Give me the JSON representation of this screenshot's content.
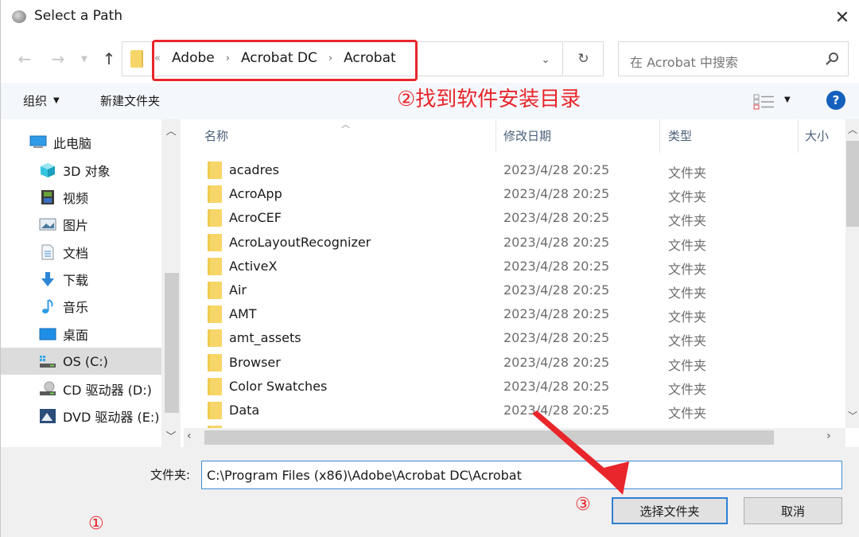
{
  "window": {
    "title": "Select a Path",
    "close_icon": "close-icon"
  },
  "nav": {
    "back_icon": "back-arrow-icon",
    "forward_icon": "forward-arrow-icon",
    "recent_icon": "chevron-down-icon",
    "up_icon": "up-arrow-icon"
  },
  "address": {
    "overflow": "«",
    "crumbs": [
      "Adobe",
      "Acrobat DC",
      "Acrobat"
    ],
    "separator": "›"
  },
  "search": {
    "placeholder": "在 Acrobat 中搜索"
  },
  "toolbar": {
    "organize_label": "组织",
    "new_folder_label": "新建文件夹",
    "help_label": "?"
  },
  "annotations": {
    "step1": "①",
    "step2": "②找到软件安装目录",
    "step3": "③",
    "color": "#e8262b"
  },
  "sidebar": {
    "items": [
      {
        "label": "此电脑",
        "icon": "computer-icon"
      },
      {
        "label": "3D 对象",
        "icon": "3d-objects-icon"
      },
      {
        "label": "视频",
        "icon": "video-icon"
      },
      {
        "label": "图片",
        "icon": "pictures-icon"
      },
      {
        "label": "文档",
        "icon": "documents-icon"
      },
      {
        "label": "下载",
        "icon": "download-icon"
      },
      {
        "label": "音乐",
        "icon": "music-icon"
      },
      {
        "label": "桌面",
        "icon": "desktop-icon"
      },
      {
        "label": "OS (C:)",
        "icon": "drive-c-icon",
        "selected": true
      },
      {
        "label": "CD 驱动器 (D:)",
        "icon": "cd-drive-icon"
      },
      {
        "label": "DVD 驱动器 (E:)",
        "icon": "dvd-drive-icon"
      }
    ]
  },
  "filelist": {
    "columns": [
      "名称",
      "修改日期",
      "类型",
      "大小"
    ],
    "rows": [
      {
        "name": "acadres",
        "date": "2023/4/28 20:25",
        "type": "文件夹"
      },
      {
        "name": "AcroApp",
        "date": "2023/4/28 20:25",
        "type": "文件夹"
      },
      {
        "name": "AcroCEF",
        "date": "2023/4/28 20:25",
        "type": "文件夹"
      },
      {
        "name": "AcroLayoutRecognizer",
        "date": "2023/4/28 20:25",
        "type": "文件夹"
      },
      {
        "name": "ActiveX",
        "date": "2023/4/28 20:25",
        "type": "文件夹"
      },
      {
        "name": "Air",
        "date": "2023/4/28 20:25",
        "type": "文件夹"
      },
      {
        "name": "AMT",
        "date": "2023/4/28 20:25",
        "type": "文件夹"
      },
      {
        "name": "amt_assets",
        "date": "2023/4/28 20:25",
        "type": "文件夹"
      },
      {
        "name": "Browser",
        "date": "2023/4/28 20:25",
        "type": "文件夹"
      },
      {
        "name": "Color Swatches",
        "date": "2023/4/28 20:25",
        "type": "文件夹"
      },
      {
        "name": "Data",
        "date": "2023/4/28 20:25",
        "type": "文件夹"
      }
    ]
  },
  "footer": {
    "folder_label": "文件夹:",
    "folder_value": "C:\\Program Files (x86)\\Adobe\\Acrobat DC\\Acrobat",
    "select_button": "选择文件夹",
    "cancel_button": "取消"
  }
}
